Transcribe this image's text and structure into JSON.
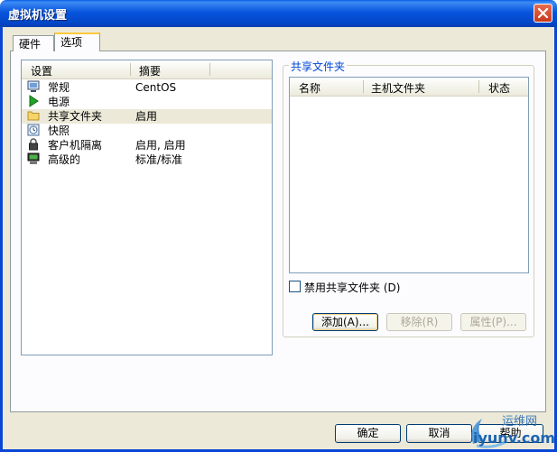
{
  "window": {
    "title": "虚拟机设置"
  },
  "tabs": [
    {
      "label": "硬件"
    },
    {
      "label": "选项"
    }
  ],
  "settings_list": {
    "headers": {
      "setting": "设置",
      "summary": "摘要"
    },
    "items": [
      {
        "label": "常规",
        "value": "CentOS",
        "icon": "monitor-icon"
      },
      {
        "label": "电源",
        "value": "",
        "icon": "power-play-icon"
      },
      {
        "label": "共享文件夹",
        "value": "启用",
        "icon": "folder-icon"
      },
      {
        "label": "快照",
        "value": "",
        "icon": "snapshot-icon"
      },
      {
        "label": "客户机隔离",
        "value": "启用, 启用",
        "icon": "lock-icon"
      },
      {
        "label": "高级的",
        "value": "标准/标准",
        "icon": "advanced-computer-icon"
      }
    ]
  },
  "shared_folders": {
    "group_title": "共享文件夹",
    "headers": {
      "name": "名称",
      "host_folder": "主机文件夹",
      "status": "状态"
    },
    "disable_checkbox_label": "禁用共享文件夹 (D)",
    "add_label": "添加(A)...",
    "remove_label": "移除(R)",
    "properties_label": "属性(P)..."
  },
  "footer": {
    "ok_label": "确定",
    "cancel_label": "取消",
    "help_label": "帮助"
  },
  "watermark": {
    "line1": "运维网",
    "line2": "iyunv.com"
  }
}
